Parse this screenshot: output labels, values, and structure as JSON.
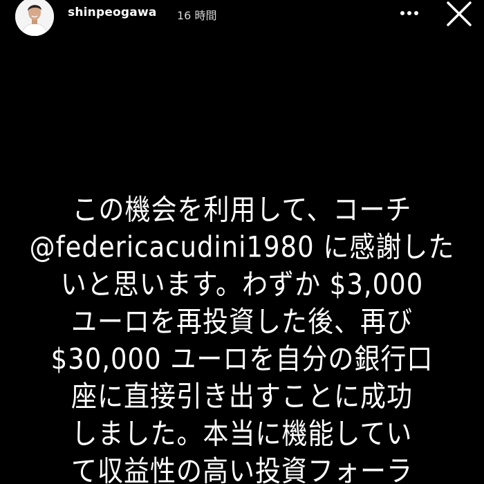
{
  "story": {
    "username": "shinpeogawa",
    "timestamp": "16 時間",
    "avatar_icon": "profile-avatar",
    "more_icon": "more-horizontal-icon",
    "close_icon": "close-icon",
    "background_color": "#000000",
    "text_color": "#ffffff",
    "lines": [
      "この機会を利用して、コーチ",
      "@federicacudini1980 に感謝した",
      "いと思います。わずか $3,000",
      "ユーロを再投資した後、再び",
      "$30,000 ユーロを自分の銀行口",
      "座に直接引き出すことに成功",
      "しました。本当に機能してい",
      "て収益性の高い投資フォーラ"
    ]
  }
}
